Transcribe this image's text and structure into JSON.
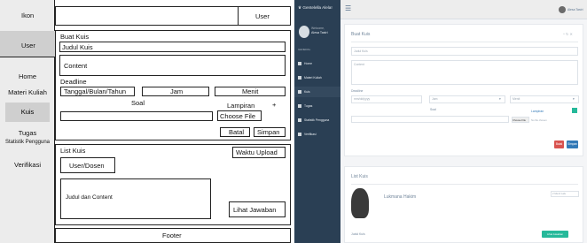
{
  "wireframe": {
    "sidebar": {
      "header": "Ikon",
      "user": "User",
      "items": [
        "Home",
        "Materi Kuliah",
        "Kuis",
        "Tugas",
        "Statistik Pengguna",
        "Verifikasi"
      ]
    },
    "header_user": "User",
    "buat_kuis": {
      "title": "Buat Kuis",
      "judul": "Judul Kuis",
      "content": "Content",
      "deadline_label": "Deadline",
      "tanggal": "Tanggal/Bulan/Tahun",
      "jam": "Jam",
      "menit": "Menit",
      "soal": "Soal",
      "lampiran": "Lampiran",
      "plus": "+",
      "choose_file": "Choose File",
      "batal": "Batal",
      "simpan": "Simpan"
    },
    "list_kuis": {
      "title": "List Kuis",
      "waktu_upload": "Waktu Upload",
      "user_dosen": "User/Dosen",
      "judul_content": "Judul dan Content",
      "lihat_jawaban": "Lihat Jawaban"
    },
    "footer": "Footer"
  },
  "app": {
    "brand": "Gentelella Alela!",
    "welcome": "Welcome,",
    "user_name": "Alesa Tastri",
    "general": "GENERAL",
    "menu": [
      {
        "label": "Home",
        "active": false
      },
      {
        "label": "Materi Kuliah",
        "active": false
      },
      {
        "label": "Kuis",
        "active": true
      },
      {
        "label": "Tugas",
        "active": false
      },
      {
        "label": "Statistik Pengguna",
        "active": false
      },
      {
        "label": "Verifikasi",
        "active": false
      }
    ],
    "top_user": "Alesa Tastri",
    "buat_kuis": {
      "title": "Buat Kuis",
      "controls": "^ ↻ ✕",
      "judul_placeholder": "Judul Kuis",
      "content_placeholder": "Content",
      "deadline_label": "Deadline",
      "date_value": "mm/dd/yyyy",
      "jam": "Jam",
      "menit": "Menit",
      "soal": "Soal",
      "lampiran": "Lampiran",
      "plus": "+",
      "choose_file": "Choose File",
      "no_file": "No file chosen",
      "batal": "Batal",
      "simpan": "Simpan"
    },
    "list_kuis": {
      "title": "List Kuis",
      "name": "Lukmana Hakim",
      "time": "2 Menit Lalu",
      "judul": "Judul Kuis",
      "lihat_jawaban": "Lihat Jawaban"
    }
  },
  "colors": {
    "nav_bg": "#2a3f54",
    "accent_green": "#26b99a",
    "danger_red": "#d9534f",
    "primary_blue": "#337ab7"
  }
}
